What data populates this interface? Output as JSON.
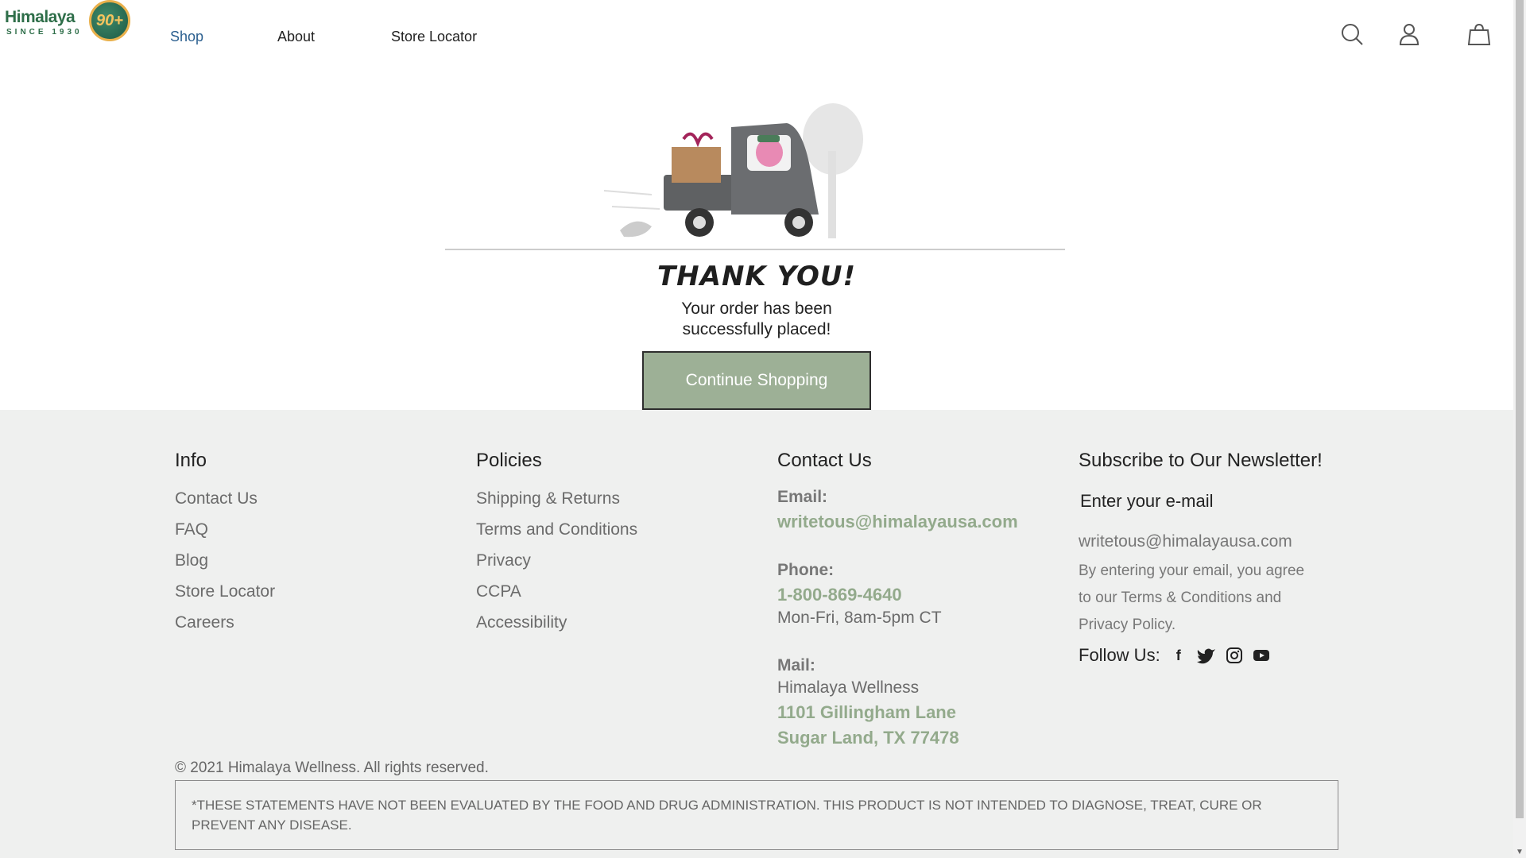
{
  "brand": {
    "logo_text": "Himalaya",
    "since": "SINCE 1930",
    "badge": "90+"
  },
  "nav": {
    "items": [
      {
        "label": "Shop"
      },
      {
        "label": "About"
      },
      {
        "label": "Store Locator"
      }
    ]
  },
  "header_icons": [
    "search-icon",
    "account-icon",
    "cart-icon"
  ],
  "confirmation": {
    "title": "THANK YOU!",
    "line1": "Your order has been",
    "line2": "successfully placed!",
    "button": "Continue Shopping"
  },
  "footer": {
    "info": {
      "heading": "Info",
      "links": [
        "Contact Us",
        "FAQ",
        "Blog",
        "Store Locator",
        "Careers"
      ]
    },
    "policies": {
      "heading": "Policies",
      "links": [
        "Shipping & Returns",
        "Terms and Conditions",
        "Privacy",
        "CCPA",
        "Accessibility"
      ]
    },
    "contact": {
      "heading": "Contact Us",
      "email_label": "Email:",
      "email": "writetous@himalayausa.com",
      "phone_label": "Phone:",
      "phone": "1-800-869-4640",
      "hours": "Mon-Fri, 8am-5pm CT",
      "mail_label": "Mail:",
      "company": "Himalaya Wellness",
      "street": "1101 Gillingham Lane",
      "city": "Sugar Land, TX 77478"
    },
    "newsletter": {
      "heading": "Subscribe to Our Newsletter!",
      "input_label": "Enter your e-mail",
      "email_value": "writetous@himalayausa.com",
      "note1": "By entering your email, you agree",
      "note2": "to our Terms & Conditions and",
      "note3": "Privacy Policy.",
      "follow": "Follow Us:",
      "socials": [
        "facebook-icon",
        "twitter-icon",
        "instagram-icon",
        "youtube-icon"
      ]
    },
    "copyright": "© 2021 Himalaya Wellness. All rights reserved.",
    "disclaimer": "*THESE STATEMENTS HAVE NOT BEEN EVALUATED BY THE FOOD AND DRUG ADMINISTRATION. THIS PRODUCT IS NOT INTENDED TO DIAGNOSE, TREAT, CURE OR PREVENT ANY DISEASE."
  },
  "colors": {
    "accent_green": "#93aa8c",
    "button_green": "#9db096",
    "footer_bg": "#eff0ef",
    "nav_active": "#2b5f8f"
  }
}
